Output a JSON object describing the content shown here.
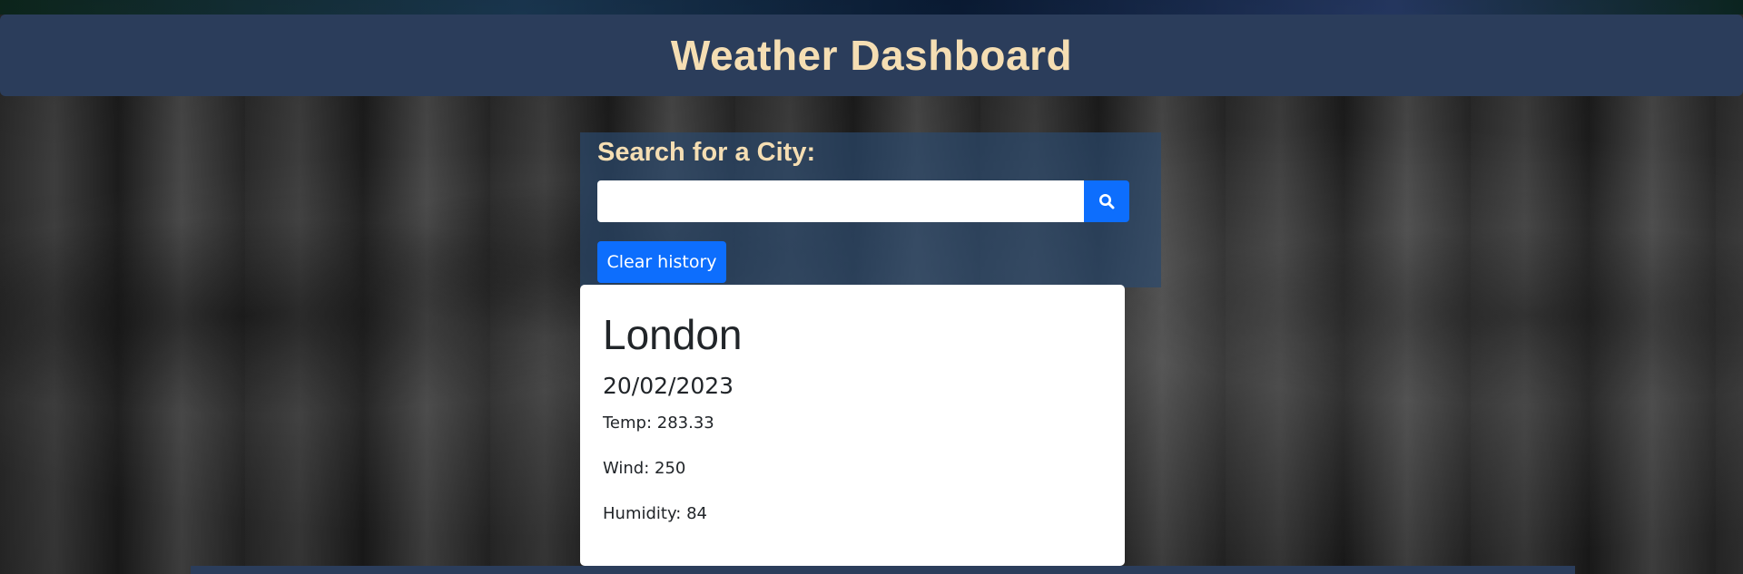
{
  "header": {
    "title": "Weather Dashboard"
  },
  "search": {
    "title": "Search for a City:",
    "input_value": "",
    "button_icon": "search-icon",
    "clear_label": "Clear history"
  },
  "current_weather": {
    "city": "London",
    "date": "20/02/2023",
    "temp": "Temp: 283.33",
    "wind": "Wind: 250",
    "humidity": "Humidity: 84"
  },
  "colors": {
    "header_bg": "#2b3d5b",
    "title_color": "#f5deb3",
    "accent_blue": "#0d6efd",
    "card_bg": "#ffffff"
  }
}
